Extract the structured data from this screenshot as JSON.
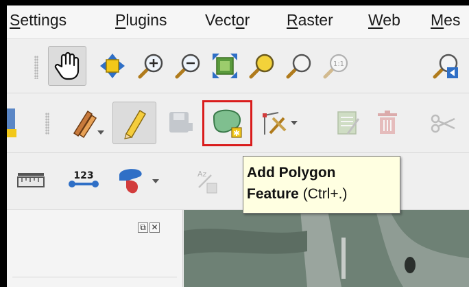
{
  "menubar": {
    "items": [
      {
        "pre": "",
        "ul": "S",
        "post": "ettings"
      },
      {
        "pre": "",
        "ul": "P",
        "post": "lugins"
      },
      {
        "pre": "Vect",
        "ul": "o",
        "post": "r"
      },
      {
        "pre": "",
        "ul": "R",
        "post": "aster"
      },
      {
        "pre": "",
        "ul": "W",
        "post": "eb"
      },
      {
        "pre": "",
        "ul": "M",
        "post": "es"
      }
    ]
  },
  "toolbar_nav": {
    "icons": [
      "pan-map-icon",
      "pan-to-selection-icon",
      "zoom-in-icon",
      "zoom-out-icon",
      "zoom-full-icon",
      "zoom-to-selection-icon",
      "zoom-to-layer-icon",
      "zoom-native-icon",
      "zoom-last-icon"
    ],
    "zoom_native_text": "1:1"
  },
  "toolbar_digitize": {
    "icons": [
      "layer-icon",
      "current-edits-icon",
      "toggle-editing-icon",
      "save-edits-icon",
      "add-polygon-feature-icon",
      "vertex-tool-icon",
      "modify-attributes-icon",
      "delete-selected-icon",
      "cut-features-icon"
    ]
  },
  "toolbar_measure": {
    "icons": [
      "measure-line-icon",
      "identify-features-icon",
      "style-manager-icon",
      "label-toolbar-icon"
    ],
    "identify_text": "123",
    "label_text": "Az"
  },
  "tooltip": {
    "title_line1": "Add Polygon",
    "title_line2": "Feature",
    "shortcut": "(Ctrl+.)"
  },
  "panel": {
    "float_button": "⧉",
    "close_button": "✕"
  },
  "colors": {
    "highlight": "#d91c1c",
    "tooltip_bg": "#ffffe1",
    "polygon_fill": "#7fbf8f"
  }
}
